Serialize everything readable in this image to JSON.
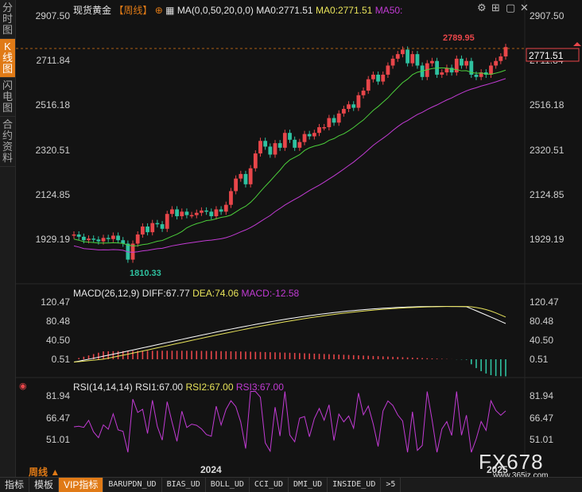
{
  "sidebar": {
    "tabs": [
      {
        "label": "分时图",
        "active": false
      },
      {
        "label": "K线图",
        "active": true
      },
      {
        "label": "闪电图",
        "active": false
      },
      {
        "label": "合约资料",
        "active": false
      }
    ]
  },
  "header": {
    "instrument": "现货黄金",
    "period": "【周线】",
    "ma_label": "MA(0,0,50,20,0,0)",
    "ma0a": "MA0:2771.51",
    "ma0b": "MA0:2771.51",
    "ma50": "MA50:"
  },
  "top_icons": [
    "gear-icon",
    "layout-icon",
    "window-icon",
    "close-icon"
  ],
  "price_axis": {
    "ticks": [
      "2907.50",
      "2711.84",
      "2516.18",
      "2320.51",
      "2124.85",
      "1929.19"
    ]
  },
  "price_labels": {
    "high": "2789.95",
    "low": "1810.33",
    "last": "2771.51"
  },
  "macd": {
    "title": "MACD(26,12,9)",
    "diff": "DIFF:67.77",
    "dea": "DEA:74.06",
    "macd": "MACD:-12.58",
    "ticks": [
      "120.47",
      "80.48",
      "40.50",
      "0.51"
    ]
  },
  "rsi": {
    "title": "RSI(14,14,14)",
    "rsi1": "RSI1:67.00",
    "rsi2": "RSI2:67.00",
    "rsi3": "RSI3:67.00",
    "ticks": [
      "81.94",
      "66.47",
      "51.01"
    ]
  },
  "xaxis": {
    "period": "周线",
    "labels": [
      "2024",
      "2025"
    ]
  },
  "toolbar": [
    "指标",
    "模板",
    "VIP指标",
    "BARUPDN_UD",
    "BIAS_UD",
    "BOLL_UD",
    "CCI_UD",
    "DMI_UD",
    "INSIDE_UD",
    ">5"
  ],
  "watermark": {
    "brand": "FX678",
    "url": "www.365jz.com"
  },
  "colors": {
    "up": "#e8464a",
    "down": "#2fc1a0",
    "ma20": "#4ccf3b",
    "ma50": "#c23bd4",
    "accent": "#e07a16",
    "diff": "#ffffff",
    "dea": "#e8e35a"
  }
}
